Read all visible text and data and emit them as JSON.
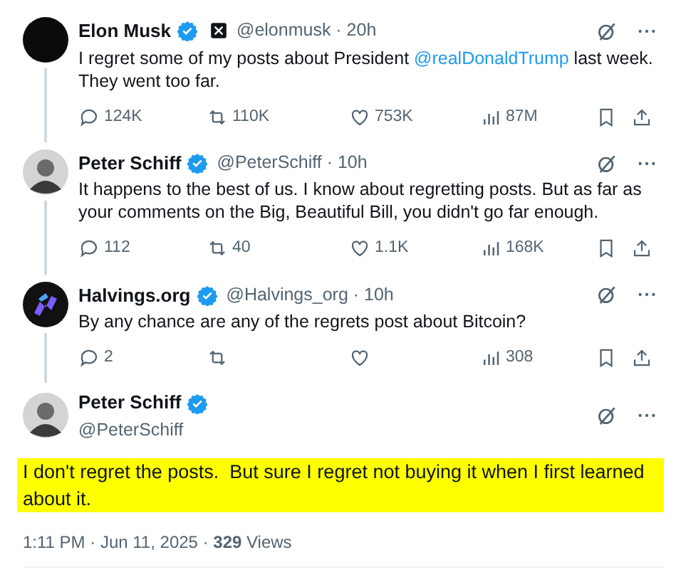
{
  "replies": [
    {
      "avatar": {
        "kind": "dark"
      },
      "name": "Elon Musk",
      "verified": true,
      "affiliate_badge": true,
      "meta": "@elonmusk · 20h",
      "text": [
        {
          "kind": "plain",
          "text": "I regret some of my posts about President "
        },
        {
          "kind": "mention",
          "text": "@realDonaldTrump"
        },
        {
          "kind": "plain",
          "text": " last week. They went too far."
        }
      ],
      "stats": {
        "replies": "124K",
        "reposts": "110K",
        "likes": "753K",
        "views": "87M"
      }
    },
    {
      "avatar": {
        "kind": "gray"
      },
      "name": "Peter Schiff",
      "verified": true,
      "affiliate_badge": false,
      "meta": "@PeterSchiff · 10h",
      "text": [
        {
          "kind": "plain",
          "text": "It happens to the best of us. I know about regretting posts. But as far as your comments on the Big, Beautiful Bill, you didn't go far enough."
        }
      ],
      "stats": {
        "replies": "112",
        "reposts": "40",
        "likes": "1.1K",
        "views": "168K"
      }
    },
    {
      "avatar": {
        "kind": "logo"
      },
      "name": "Halvings.org",
      "verified": true,
      "affiliate_badge": false,
      "meta": "@Halvings_org · 10h",
      "text": [
        {
          "kind": "plain",
          "text": "By any chance are any of the regrets post about Bitcoin?"
        }
      ],
      "stats": {
        "replies": "2",
        "views": "308"
      }
    }
  ],
  "main_post": {
    "avatar": {
      "kind": "gray"
    },
    "name": "Peter Schiff",
    "verified": true,
    "handle": "@PeterSchiff",
    "text": "I don't regret the posts.  But sure I regret not buying it when I first learned about it.",
    "highlighted": true,
    "footer": "1:11 PM · Jun 11, 2025 · **329** Views"
  }
}
